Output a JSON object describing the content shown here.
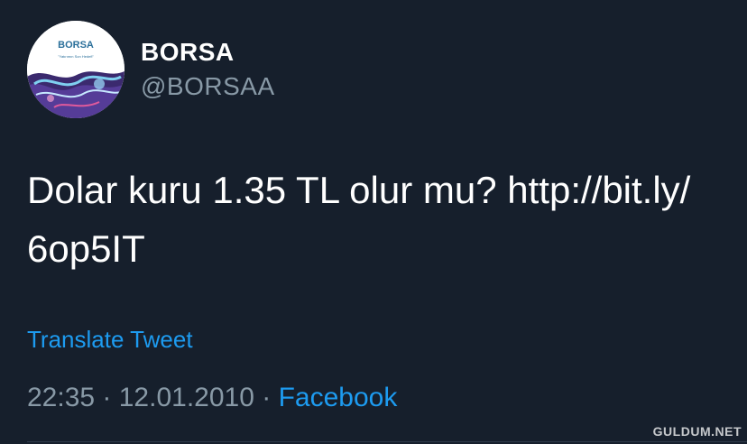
{
  "author": {
    "display_name": "BORSA",
    "handle": "@BORSAA",
    "avatar_logo_text": "BORSA"
  },
  "tweet": {
    "text_line1": "Dolar kuru 1.35 TL olur mu? http://bit.ly/",
    "text_line2": "6op5IT",
    "translate_label": "Translate Tweet",
    "time": "22:35",
    "separator": " · ",
    "date": "12.01.2010",
    "source": "Facebook"
  },
  "watermark": "GULDUM.NET",
  "colors": {
    "background": "#161f2c",
    "link": "#1d9bf0",
    "secondary_text": "#8899a6"
  }
}
